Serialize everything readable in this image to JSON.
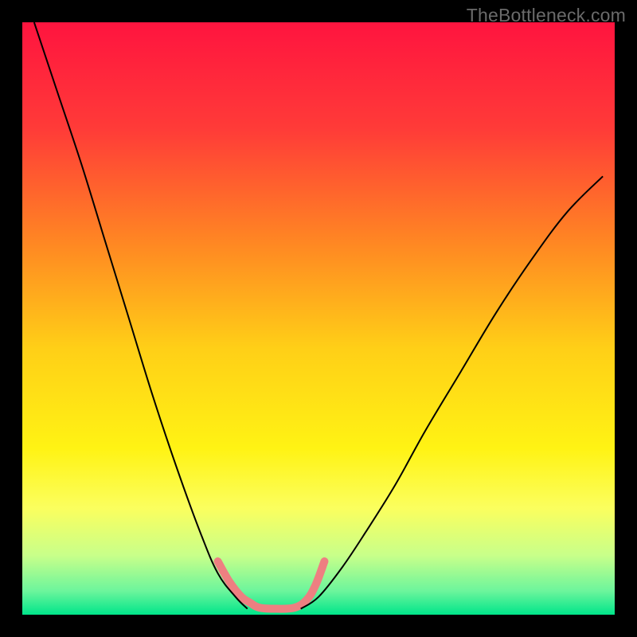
{
  "watermark": "TheBottleneck.com",
  "chart_data": {
    "type": "line",
    "title": "",
    "xlabel": "",
    "ylabel": "",
    "xlim": [
      0,
      100
    ],
    "ylim": [
      0,
      100
    ],
    "grid": false,
    "background_gradient": {
      "type": "vertical",
      "stops": [
        {
          "pos": 0.0,
          "color": "#ff143f"
        },
        {
          "pos": 0.18,
          "color": "#ff3b38"
        },
        {
          "pos": 0.38,
          "color": "#ff8a22"
        },
        {
          "pos": 0.55,
          "color": "#ffcf17"
        },
        {
          "pos": 0.72,
          "color": "#fff314"
        },
        {
          "pos": 0.82,
          "color": "#fbff5e"
        },
        {
          "pos": 0.9,
          "color": "#c8ff8a"
        },
        {
          "pos": 0.96,
          "color": "#6cf59c"
        },
        {
          "pos": 1.0,
          "color": "#00e58a"
        }
      ]
    },
    "series": [
      {
        "name": "left-branch-curve",
        "stroke": "#000000",
        "stroke_width": 2,
        "x": [
          2,
          6,
          10,
          14,
          18,
          22,
          26,
          30,
          33,
          36,
          38
        ],
        "y": [
          100,
          88,
          76,
          63,
          50,
          37,
          25,
          14,
          7,
          3,
          1
        ]
      },
      {
        "name": "right-branch-curve",
        "stroke": "#000000",
        "stroke_width": 2,
        "x": [
          47,
          50,
          54,
          58,
          63,
          68,
          74,
          80,
          86,
          92,
          98
        ],
        "y": [
          1,
          3,
          8,
          14,
          22,
          31,
          41,
          51,
          60,
          68,
          74
        ]
      },
      {
        "name": "valley-floor-highlight",
        "stroke": "#ee7f81",
        "stroke_width": 10,
        "linecap": "round",
        "x": [
          33,
          35,
          37,
          38.5,
          40,
          43,
          46,
          48,
          49.5,
          51
        ],
        "y": [
          9,
          5.5,
          3,
          2,
          1.2,
          1,
          1.2,
          2.5,
          5,
          9
        ]
      }
    ]
  }
}
